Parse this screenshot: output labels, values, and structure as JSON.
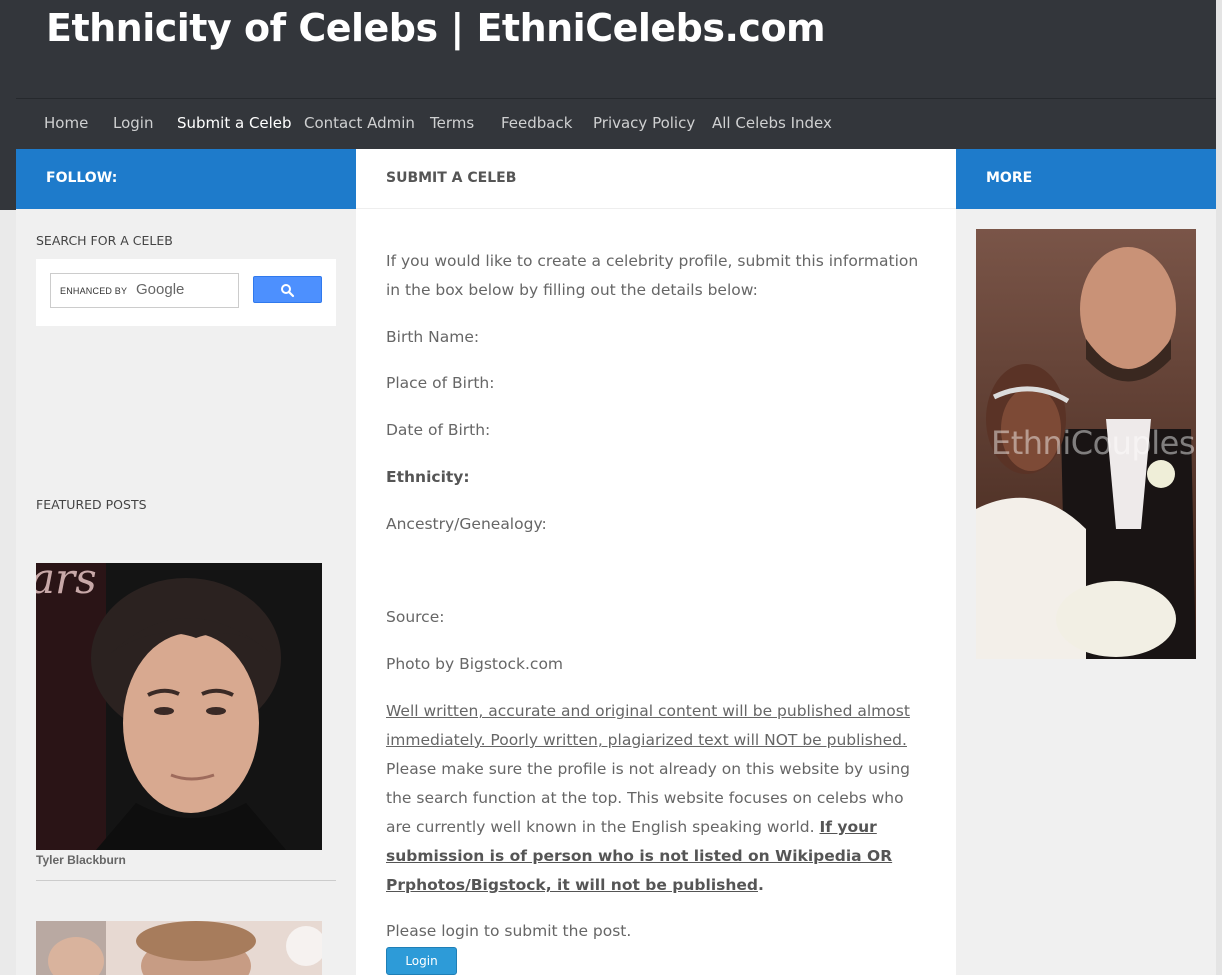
{
  "site": {
    "title": "Ethnicity of Celebs | EthniCelebs.com"
  },
  "nav": {
    "items": [
      {
        "label": "Home"
      },
      {
        "label": "Login"
      },
      {
        "label": "Submit a Celeb"
      },
      {
        "label": "Contact Admin"
      },
      {
        "label": "Terms"
      },
      {
        "label": "Feedback"
      },
      {
        "label": "Privacy Policy"
      },
      {
        "label": "All Celebs Index"
      }
    ],
    "active": "Submit a Celeb"
  },
  "bars": {
    "follow": "FOLLOW:",
    "page_title": "SUBMIT A CELEB",
    "more": "MORE"
  },
  "sidebar_left": {
    "search_title": "SEARCH FOR A CELEB",
    "search_enhanced": "ENHANCED BY",
    "search_brand": "Google",
    "featured_title": "FEATURED POSTS",
    "featured_caption": "Tyler Blackburn"
  },
  "main": {
    "intro": "If you would like to create a celebrity profile, submit this information in the box below by filling out the details below:",
    "birth_name": "Birth Name:",
    "place_of_birth": "Place of Birth:",
    "date_of_birth": "Date of Birth:",
    "ethnicity": "Ethnicity:",
    "ancestry": "Ancestry/Genealogy:",
    "source": "Source:",
    "photo_credit": "Photo by Bigstock.com",
    "notice_underlined": "Well written, accurate and original content will be published almost immediately. Poorly written, plagiarized text will NOT be published.",
    "notice_plain": " Please make sure the profile is not already on this website by using the search function at the top. This website focuses on celebs who are currently well known in the English speaking world. ",
    "notice_bold": "If your submission is of person who is not listed on Wikipedia OR Prphotos/Bigstock, it will not be published",
    "notice_end": ".",
    "login_prompt": "Please login to submit the post.",
    "login_button": "Login"
  },
  "sidebar_right": {
    "ad_watermark": "EthniCouples."
  },
  "colors": {
    "header_bg": "#33363b",
    "accent_blue": "#1e7bcb",
    "button_blue": "#2d9bd8"
  }
}
